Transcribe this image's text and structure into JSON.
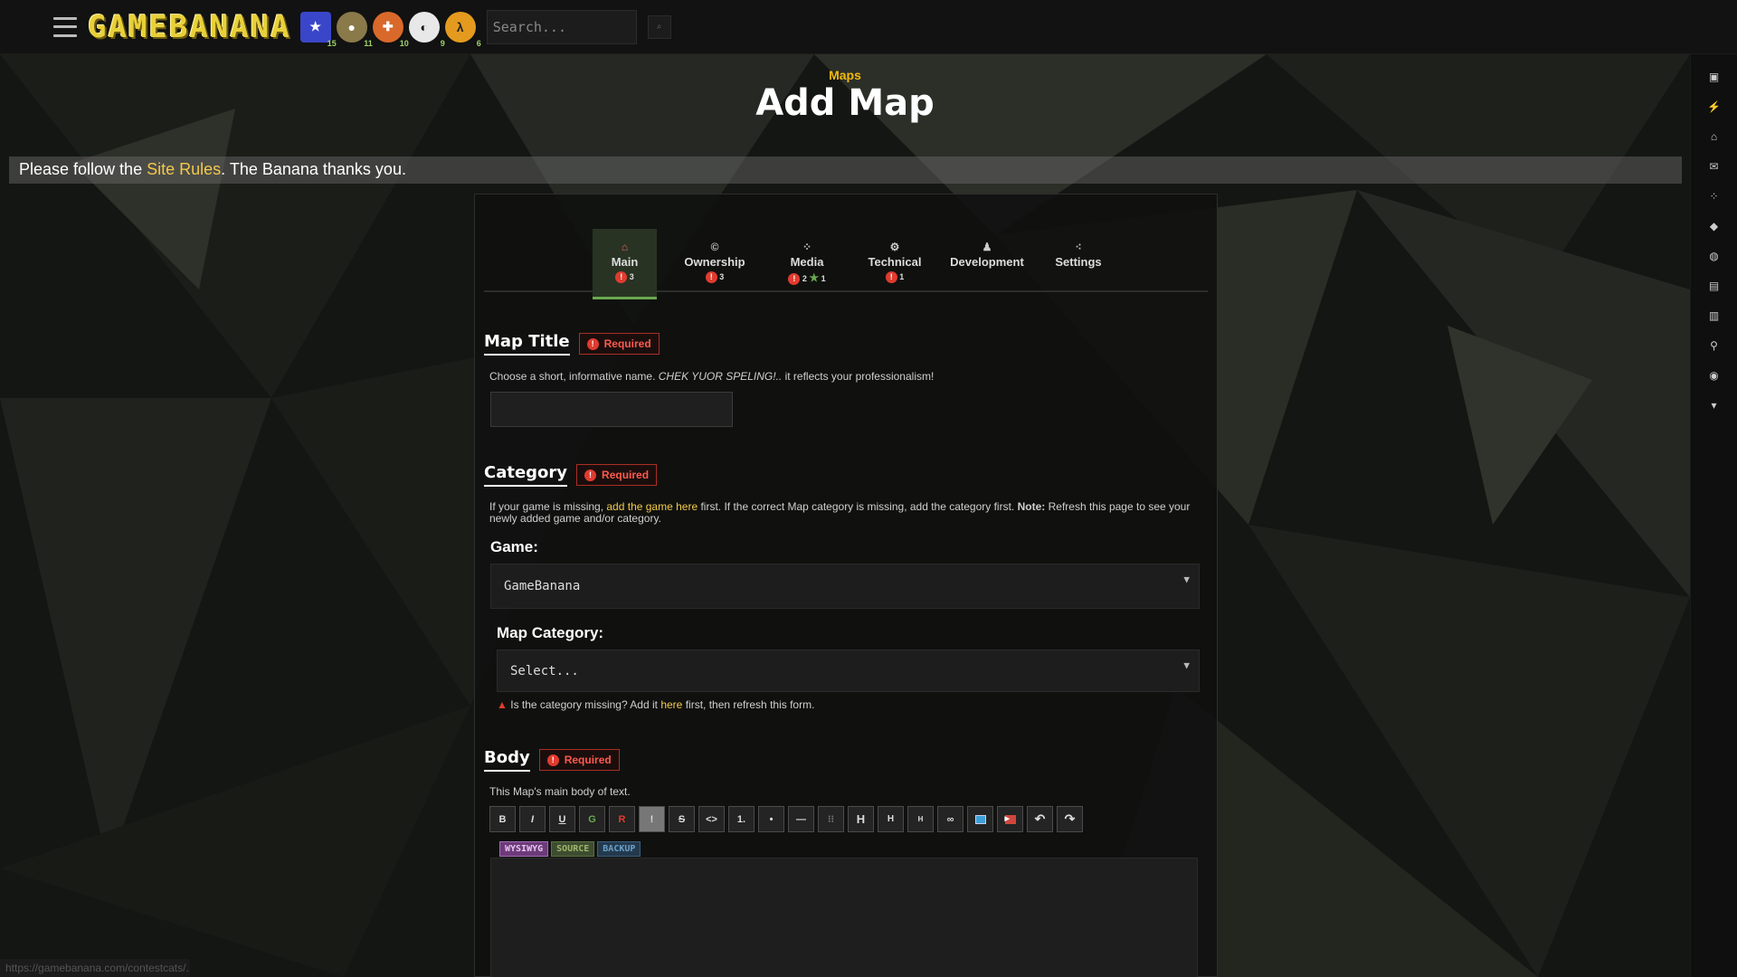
{
  "topbar": {
    "logo": "GAMEBANANA",
    "search_placeholder": "Search...",
    "games": [
      {
        "icon": "game-icon-1",
        "count": "15",
        "color": "#3a46c9"
      },
      {
        "icon": "game-icon-2",
        "count": "11",
        "color": "#8a7a4a"
      },
      {
        "icon": "game-icon-3",
        "count": "10",
        "color": "#d9692b"
      },
      {
        "icon": "game-icon-4",
        "count": "9",
        "color": "#e8e8e8"
      },
      {
        "icon": "game-icon-5",
        "count": "6",
        "color": "#e39a1f"
      }
    ]
  },
  "header": {
    "breadcrumb": "Maps",
    "title": "Add Map"
  },
  "rules": {
    "prefix": "Please follow the ",
    "link": "Site Rules",
    "suffix": ". The Banana thanks you."
  },
  "tabs": [
    {
      "label": "Main",
      "icon": "home-icon",
      "errors": "3",
      "stars": ""
    },
    {
      "label": "Ownership",
      "icon": "copyright-icon",
      "errors": "3",
      "stars": ""
    },
    {
      "label": "Media",
      "icon": "grid-icon",
      "errors": "2",
      "stars": "1"
    },
    {
      "label": "Technical",
      "icon": "gear-icon",
      "errors": "1",
      "stars": ""
    },
    {
      "label": "Development",
      "icon": "person-icon",
      "errors": "",
      "stars": ""
    },
    {
      "label": "Settings",
      "icon": "dots-icon",
      "errors": "",
      "stars": ""
    }
  ],
  "map_title": {
    "heading": "Map Title",
    "required": "Required",
    "hint_before": "Choose a short, informative name. ",
    "hint_em": "CHEK YUOR SPELING!..",
    "hint_after": " it reflects your professionalism!",
    "value": ""
  },
  "category": {
    "heading": "Category",
    "required": "Required",
    "hint_1": "If your game is missing, ",
    "hint_link": "add the game here",
    "hint_2": " first. If the correct Map category is missing, add the category first. ",
    "hint_note": "Note:",
    "hint_3": " Refresh this page to see your newly added game and/or category.",
    "game_label": "Game:",
    "game_value": "GameBanana",
    "map_category_label": "Map Category:",
    "map_category_value": "Select...",
    "warning_1": "Is the category missing? Add it ",
    "warning_link": "here",
    "warning_2": " first, then refresh this form."
  },
  "body": {
    "heading": "Body",
    "required": "Required",
    "hint": "This Map's main body of text.",
    "toolbar": [
      "B",
      "I",
      "U",
      "G",
      "R",
      "!",
      "S",
      "<>",
      "1.",
      "•",
      "—",
      "⁝⁝",
      "H",
      "H",
      "H",
      "∞",
      "img",
      "▶",
      "↶",
      "↷"
    ],
    "modes": [
      "WYSIWYG",
      "SOURCE",
      "BACKUP"
    ]
  },
  "status_url": "https://gamebanana.com/contestcats/..."
}
